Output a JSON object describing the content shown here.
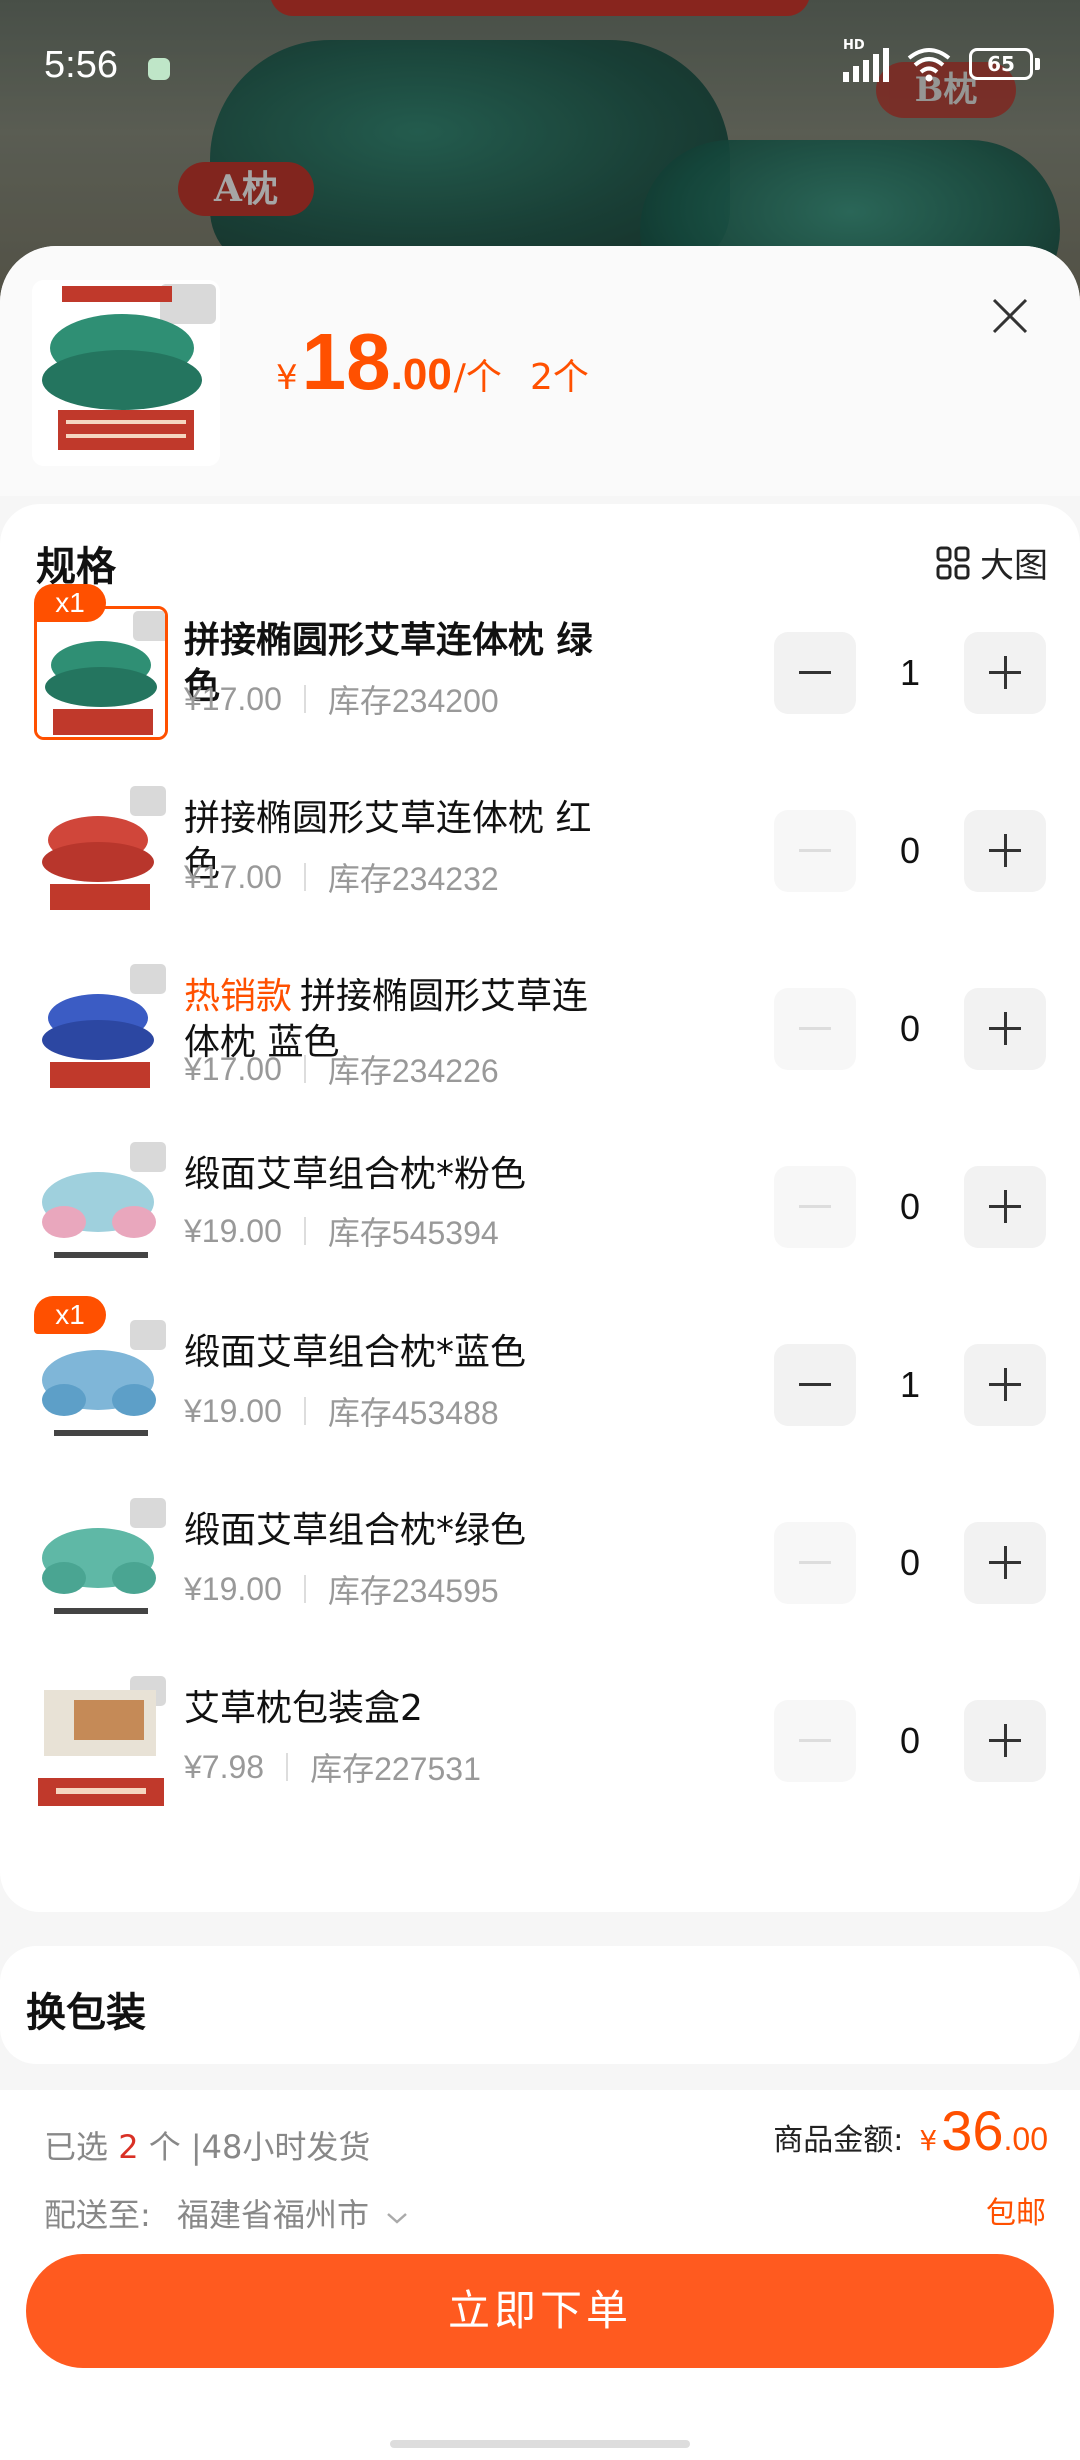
{
  "status_bar": {
    "time": "5:56",
    "network": "HD",
    "battery": "65"
  },
  "background": {
    "tag_a": "A枕",
    "tag_b": "B枕"
  },
  "header": {
    "price_yen": "¥",
    "price_int": "18",
    "price_dec": ".00",
    "price_unit": "/个",
    "count": "2个"
  },
  "spec": {
    "title": "规格",
    "big_image_label": "大图",
    "items": [
      {
        "name": "拼接椭圆形艾草连体枕 绿色",
        "hot": "",
        "price": "¥17.00",
        "stock": "库存234200",
        "qty": "1",
        "badge": "x1",
        "theme": "green"
      },
      {
        "name": "拼接椭圆形艾草连体枕 红色",
        "hot": "",
        "price": "¥17.00",
        "stock": "库存234232",
        "qty": "0",
        "badge": "",
        "theme": "red"
      },
      {
        "name": "拼接椭圆形艾草连体枕 蓝色",
        "hot": "热销款",
        "name_line1": "拼接椭圆形艾草连",
        "name_line2": "体枕 蓝色",
        "price": "¥17.00",
        "stock": "库存234226",
        "qty": "0",
        "badge": "",
        "theme": "blue"
      },
      {
        "name": "缎面艾草组合枕*粉色",
        "hot": "",
        "price": "¥19.00",
        "stock": "库存545394",
        "qty": "0",
        "badge": "",
        "theme": "pink"
      },
      {
        "name": "缎面艾草组合枕*蓝色",
        "hot": "",
        "price": "¥19.00",
        "stock": "库存453488",
        "qty": "1",
        "badge": "x1",
        "theme": "skyblue"
      },
      {
        "name": "缎面艾草组合枕*绿色",
        "hot": "",
        "price": "¥19.00",
        "stock": "库存234595",
        "qty": "0",
        "badge": "",
        "theme": "teal"
      },
      {
        "name": "艾草枕包装盒2",
        "hot": "",
        "price": "¥7.98",
        "stock": "库存227531",
        "qty": "0",
        "badge": "",
        "theme": "box"
      }
    ]
  },
  "repack": {
    "title": "换包装"
  },
  "footer": {
    "selected_prefix": "已选",
    "selected_num": "2",
    "selected_suffix": "个 |48小时发货",
    "ship_label": "配送至:",
    "ship_addr": "福建省福州市",
    "amount_label": "商品金额:",
    "amount_yen": "¥",
    "amount_int": "36",
    "amount_dec": ".00",
    "free_shipping": "包邮",
    "order_button": "立即下单"
  },
  "colors": {
    "accent": "#ff5000",
    "button": "#ff5a1f"
  }
}
